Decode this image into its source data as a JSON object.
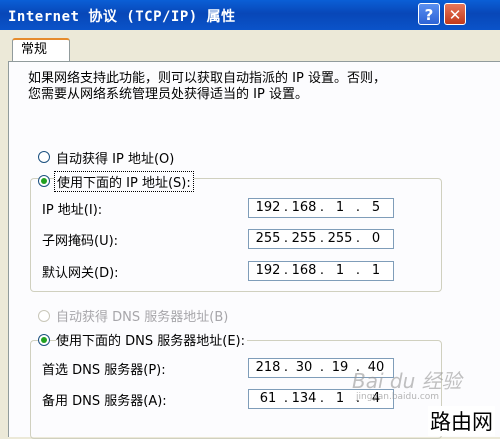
{
  "window": {
    "title": "Internet 协议 (TCP/IP) 属性",
    "help_label": "?",
    "close_label": "✕"
  },
  "tab": {
    "label": "常规"
  },
  "description": {
    "line1": "如果网络支持此功能，则可以获取自动指派的 IP 设置。否则，",
    "line2": "您需要从网络系统管理员处获得适当的 IP 设置。"
  },
  "ip_mode": {
    "auto_label": "自动获得 IP 地址(O)",
    "manual_label": "使用下面的 IP 地址(S):",
    "selected": "manual"
  },
  "ip_fields": [
    {
      "label": "IP 地址(I):",
      "octets": [
        "192",
        "168",
        "1",
        "5"
      ]
    },
    {
      "label": "子网掩码(U):",
      "octets": [
        "255",
        "255",
        "255",
        "0"
      ]
    },
    {
      "label": "默认网关(D):",
      "octets": [
        "192",
        "168",
        "1",
        "1"
      ]
    }
  ],
  "dns_mode": {
    "auto_label": "自动获得 DNS 服务器地址(B)",
    "manual_label": "使用下面的 DNS 服务器地址(E):",
    "selected": "manual"
  },
  "dns_fields": [
    {
      "label": "首选 DNS 服务器(P):",
      "octets": [
        "218",
        "30",
        "19",
        "40"
      ]
    },
    {
      "label": "备用 DNS 服务器(A):",
      "octets": [
        "61",
        "134",
        "1",
        "4"
      ]
    }
  ],
  "watermark": {
    "baidu": "Bai du 经验",
    "baidu_url": "jingyan.baidu.com",
    "site": "路由网"
  }
}
